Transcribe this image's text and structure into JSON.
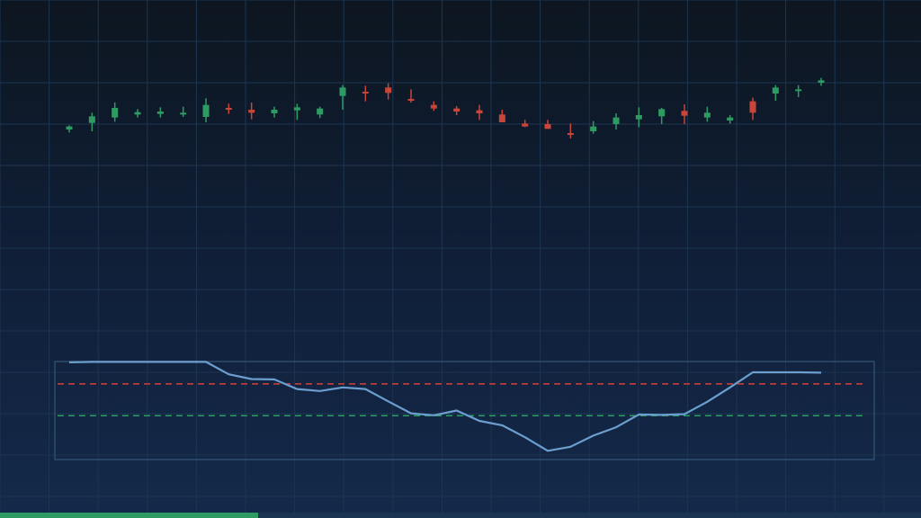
{
  "chart_data": [
    {
      "type": "candlestick",
      "x": [
        1,
        2,
        3,
        4,
        5,
        6,
        7,
        8,
        9,
        10,
        11,
        12,
        13,
        14,
        15,
        16,
        17,
        18,
        19,
        20,
        21,
        22,
        23,
        24,
        25,
        26,
        27,
        28,
        29,
        30,
        31,
        32,
        33,
        34
      ],
      "series": [
        {
          "open": [
            -0.8,
            -0.25,
            0.2,
            0.45,
            0.5,
            0.55,
            0.25,
            1.0,
            0.85,
            0.55,
            0.8,
            0.45,
            2.0,
            2.35,
            2.7,
            1.75,
            1.25,
            0.95,
            0.8,
            0.45,
            -0.3,
            -0.35,
            -1.1,
            -0.95,
            -0.35,
            0.05,
            0.3,
            0.75,
            0.2,
            -0.05,
            1.55,
            2.2,
            2.4,
            3.1
          ],
          "high": [
            -0.45,
            0.6,
            1.45,
            0.9,
            1.05,
            1.1,
            1.8,
            1.35,
            1.45,
            1.1,
            1.35,
            1.1,
            2.9,
            2.85,
            3.05,
            2.55,
            1.55,
            1.15,
            1.25,
            0.85,
            0.0,
            0.0,
            -0.3,
            -0.1,
            0.55,
            1.05,
            1.0,
            1.3,
            1.1,
            0.4,
            1.85,
            2.9,
            2.9,
            3.5
          ],
          "low": [
            -1.05,
            -0.95,
            -0.15,
            0.2,
            0.2,
            0.25,
            -0.2,
            0.5,
            0.05,
            0.2,
            0.0,
            0.15,
            0.85,
            1.55,
            1.7,
            1.45,
            0.75,
            0.4,
            0.0,
            -0.05,
            -0.6,
            -0.7,
            -1.55,
            -1.15,
            -0.8,
            -0.6,
            -0.35,
            -0.35,
            -0.15,
            -0.3,
            0.0,
            1.6,
            1.9,
            2.85
          ],
          "close": [
            -0.55,
            0.3,
            1.0,
            0.65,
            0.7,
            0.6,
            1.25,
            0.85,
            0.6,
            0.85,
            1.05,
            0.95,
            2.7,
            2.25,
            2.25,
            1.65,
            0.95,
            0.7,
            0.55,
            -0.2,
            -0.55,
            -0.75,
            -1.15,
            -0.55,
            0.2,
            0.4,
            0.9,
            0.35,
            0.6,
            0.2,
            0.6,
            2.7,
            2.55,
            3.3
          ]
        }
      ],
      "ylim": [
        -20,
        10
      ],
      "grid": true
    },
    {
      "type": "line",
      "x": [
        1,
        2,
        3,
        4,
        5,
        6,
        7,
        8,
        9,
        10,
        11,
        12,
        13,
        14,
        15,
        16,
        17,
        18,
        19,
        20,
        21,
        22,
        23,
        24,
        25,
        26,
        27,
        28,
        29,
        30,
        31,
        32,
        33,
        34
      ],
      "series": [
        {
          "values": [
            97,
            97.5,
            97.5,
            97.5,
            97.5,
            97.5,
            97.5,
            82,
            76,
            75.5,
            63.5,
            61,
            65.5,
            63.5,
            48,
            33,
            30.5,
            36.5,
            23.5,
            18,
            3,
            -14,
            -9,
            5,
            15.5,
            31.5,
            31,
            32,
            47.5,
            65.5,
            84.5,
            84.5,
            84.5,
            84
          ]
        }
      ],
      "reference_lines": [
        {
          "value": 70,
          "color": "#c9453a",
          "style": "dashed"
        },
        {
          "value": 30,
          "color": "#2e9b63",
          "style": "dashed"
        }
      ],
      "ylim": [
        -25,
        98
      ],
      "grid": true
    }
  ],
  "colors": {
    "up": "#2e9b63",
    "down": "#c9453a",
    "line": "#6c9fcf",
    "grid": "#1c3550",
    "panel_border": "#355777",
    "progress": "#2e9b63"
  },
  "progress": {
    "fraction": 0.28
  }
}
